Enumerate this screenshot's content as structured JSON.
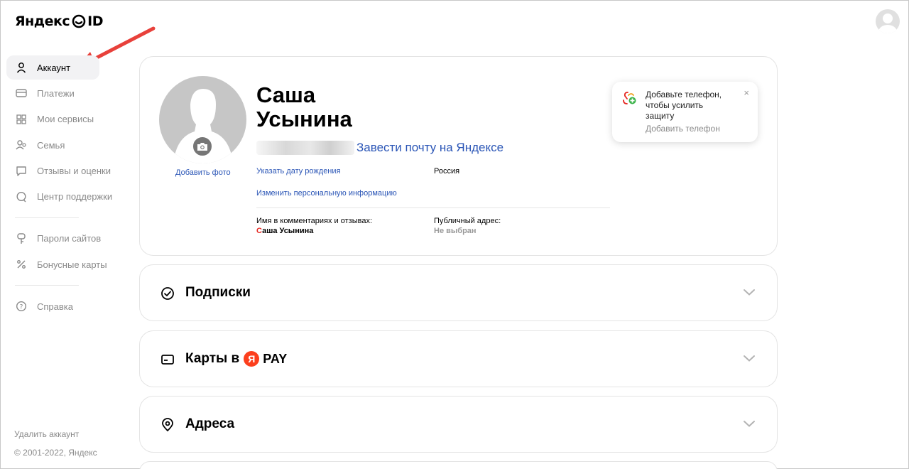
{
  "header": {
    "logo_main": "Яндекс",
    "logo_suffix": "ID"
  },
  "sidebar": {
    "items": [
      {
        "label": "Аккаунт",
        "icon": "user-icon"
      },
      {
        "label": "Платежи",
        "icon": "card-icon"
      },
      {
        "label": "Мои сервисы",
        "icon": "grid-icon"
      },
      {
        "label": "Семья",
        "icon": "family-icon"
      },
      {
        "label": "Отзывы и оценки",
        "icon": "review-icon"
      },
      {
        "label": "Центр поддержки",
        "icon": "support-icon"
      },
      {
        "label": "Пароли сайтов",
        "icon": "key-icon"
      },
      {
        "label": "Бонусные карты",
        "icon": "percent-icon"
      },
      {
        "label": "Справка",
        "icon": "help-icon"
      }
    ],
    "delete_account": "Удалить аккаунт",
    "copyright": "© 2001-2022, Яндекс"
  },
  "profile": {
    "first_name": "Саша",
    "last_name": "Усынина",
    "add_photo": "Добавить фото",
    "create_mail": "Завести почту на Яндексе",
    "birthday_link": "Указать дату рождения",
    "country": "Россия",
    "edit_info_link": "Изменить персональную информацию",
    "comments_name_label": "Имя в комментариях и отзывах:",
    "comments_name_first_letter": "С",
    "comments_name_rest": "аша Усынина",
    "public_address_label": "Публичный адрес:",
    "public_address_value": "Не выбран"
  },
  "phone_tip": {
    "text": "Добавьте телефон, чтобы усилить защиту",
    "action": "Добавить телефон",
    "close": "×"
  },
  "sections": {
    "subscriptions": "Подписки",
    "cards_prefix": "Карты в",
    "cards_badge": "Я",
    "cards_pay": "PAY",
    "addresses": "Адреса"
  },
  "colors": {
    "link": "#2a55b6",
    "accent_red": "#e52620",
    "yandex_red": "#fc3f1d",
    "arrow": "#e8413b"
  }
}
